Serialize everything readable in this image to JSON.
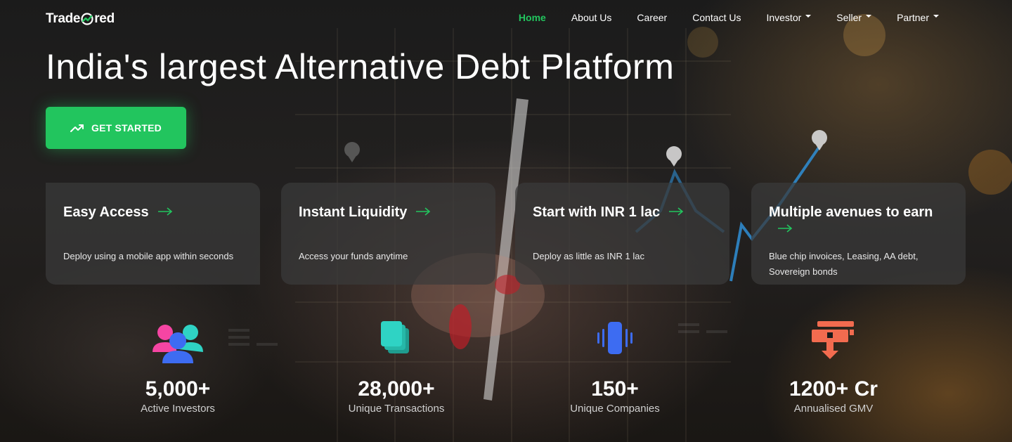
{
  "brand": {
    "name_left": "Trade",
    "name_right": "red",
    "accent_color": "#22c55e"
  },
  "nav": {
    "items": [
      {
        "label": "Home",
        "active": true,
        "dropdown": false
      },
      {
        "label": "About Us",
        "active": false,
        "dropdown": false
      },
      {
        "label": "Career",
        "active": false,
        "dropdown": false
      },
      {
        "label": "Contact Us",
        "active": false,
        "dropdown": false
      },
      {
        "label": "Investor",
        "active": false,
        "dropdown": true
      },
      {
        "label": "Seller",
        "active": false,
        "dropdown": true
      },
      {
        "label": "Partner",
        "active": false,
        "dropdown": true
      }
    ]
  },
  "hero": {
    "headline": "India's largest Alternative Debt Platform",
    "cta_label": "GET STARTED",
    "cta_icon": "trending-up-icon"
  },
  "features": [
    {
      "title": "Easy Access",
      "description": "Deploy using a mobile app within seconds"
    },
    {
      "title": "Instant Liquidity",
      "description": "Access your funds anytime"
    },
    {
      "title": "Start with INR 1 lac",
      "description": "Deploy as little as INR 1 lac"
    },
    {
      "title": "Multiple avenues to earn",
      "description": "Blue chip invoices, Leasing, AA debt, Sovereign bonds"
    }
  ],
  "stats": [
    {
      "value": "5,000+",
      "label": "Active Investors",
      "icon": "users-icon"
    },
    {
      "value": "28,000+",
      "label": "Unique Transactions",
      "icon": "documents-stack-icon"
    },
    {
      "value": "150+",
      "label": "Unique Companies",
      "icon": "building-vibrate-icon"
    },
    {
      "value": "1200+ Cr",
      "label": "Annualised GMV",
      "icon": "cash-register-icon"
    }
  ]
}
